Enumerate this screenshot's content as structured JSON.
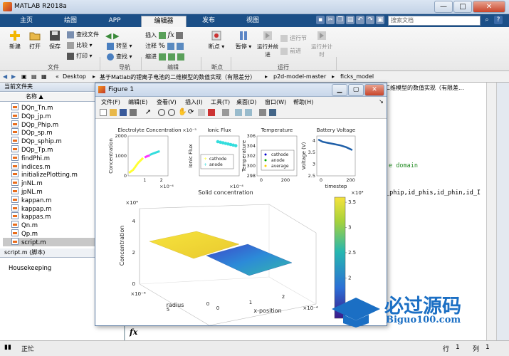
{
  "app": {
    "title": "MATLAB R2018a",
    "window_buttons": [
      "—",
      "□",
      "✕"
    ]
  },
  "ribbon": {
    "tabs": [
      "主页",
      "绘图",
      "APP",
      "编辑器",
      "发布",
      "视图"
    ],
    "active_tab": "编辑器",
    "search_placeholder": "搜索文档"
  },
  "toolstrip": {
    "file": {
      "new": "新建",
      "open": "打开",
      "save": "保存",
      "find_files": "查找文件",
      "compare": "比较",
      "print": "打印",
      "group": "文件"
    },
    "nav": {
      "goto": "转至",
      "find": "查找",
      "group": "导航"
    },
    "edit": {
      "insert": "插入",
      "comment": "注释",
      "indent": "缩进",
      "fx": "fx",
      "group": "编辑"
    },
    "breakpoints": {
      "label": "断点",
      "group": "断点"
    },
    "run": {
      "pause": "暂停",
      "run_advance": "运行并前进",
      "run_section": "运行节",
      "advance": "前进",
      "run_time": "运行并计时",
      "group": "运行"
    }
  },
  "address": {
    "crumbs": [
      "Desktop",
      "基于Matlab的锂离子电池的二维模型的数值实现（有限差分）",
      "p2d-model-master",
      "ficks_model"
    ]
  },
  "left_panel": {
    "header": "当前文件夹",
    "column": "名称",
    "sort_indicator": "▲",
    "files": [
      "DQn_Tn.m",
      "DQp_jp.m",
      "DQp_Phip.m",
      "DQp_sp.m",
      "DQp_sphip.m",
      "DQp_Tp.m",
      "findPhi.m",
      "indices.m",
      "initializePlotting.m",
      "jnNL.m",
      "jpNL.m",
      "kappan.m",
      "kappap.m",
      "kappas.m",
      "Qn.m",
      "Qp.m",
      "script.m"
    ],
    "selected_file": "script.m",
    "details_header": "script.m  (脚本)",
    "details_text": "Housekeeping"
  },
  "editor": {
    "tab_title": "二维模型的数值实现（有限差...",
    "line_comment": "e domain",
    "line_code": "_phip,id_phis,id_phin,id_I",
    "fx_label": "fx"
  },
  "status": {
    "text": "正忙",
    "row_label": "行",
    "row_value": "1",
    "col_label": "列",
    "col_value": "1"
  },
  "figure": {
    "title": "Figure 1",
    "menu": [
      "文件(F)",
      "编辑(E)",
      "查看(V)",
      "插入(I)",
      "工具(T)",
      "桌面(D)",
      "窗口(W)",
      "帮助(H)"
    ]
  },
  "chart_data": [
    {
      "type": "line",
      "title": "Electrolyte Concentration",
      "ylabel": "Concentration",
      "xlabel": "",
      "x_exponent": "×10⁻⁴",
      "xlim": [
        0,
        2.4
      ],
      "ylim": [
        0,
        2000
      ],
      "yticks": [
        0,
        1000,
        2000
      ],
      "xticks": [
        1,
        2
      ],
      "series": [
        {
          "color": "#ffff33",
          "x": [
            0.05,
            0.3,
            0.6,
            0.9
          ],
          "y": [
            150,
            300,
            650,
            900
          ]
        },
        {
          "color": "#ff33ff",
          "x": [
            1.0,
            1.1,
            1.2,
            1.3
          ],
          "y": [
            920,
            970,
            1000,
            1030
          ]
        },
        {
          "color": "#33dddd",
          "x": [
            1.3,
            1.5,
            1.7,
            1.9
          ],
          "y": [
            1050,
            1120,
            1180,
            1240
          ]
        }
      ]
    },
    {
      "type": "scatter",
      "title": "Ionic Flux",
      "ylabel": "Ionic Flux",
      "y_exponent": "×10⁻⁵",
      "x_exponent": "×10⁻⁴",
      "legend": [
        "cathode",
        "anode"
      ],
      "legend_colors": [
        "#ffff33",
        "#33dddd"
      ]
    },
    {
      "type": "scatter",
      "title": "Temperature",
      "ylabel": "Temperature",
      "yticks": [
        298,
        300,
        302,
        304,
        306
      ],
      "xticks": [
        0,
        200
      ],
      "ylim": [
        298,
        306
      ],
      "legend": [
        "cathode",
        "anode",
        "average"
      ],
      "legend_colors": [
        "#0000cc",
        "#00aa00",
        "#ffcc00"
      ]
    },
    {
      "type": "line",
      "title": "Battery Voltage",
      "ylabel": "Voltage (V)",
      "xlabel": "timestep",
      "yticks": [
        2.5,
        3,
        3.5,
        4
      ],
      "xticks": [
        0,
        200
      ],
      "ylim": [
        2.5,
        4.2
      ],
      "series": [
        {
          "color": "#1f5fa8",
          "x": [
            10,
            40,
            80,
            120,
            160,
            200,
            240
          ],
          "y": [
            4.05,
            3.95,
            3.9,
            3.85,
            3.8,
            3.72,
            3.6
          ]
        }
      ]
    },
    {
      "type": "heatmap",
      "title": "Solid concentration",
      "xlabel": "x-position",
      "ylabel": "radius",
      "zlabel": "Concentration",
      "z_exponent": "×10⁴",
      "x_exponent": "×10⁻⁴",
      "y_exponent": "×10⁻⁶",
      "zticks": [
        0,
        2,
        4
      ],
      "xticks": [
        0,
        1,
        2
      ],
      "yticks": [
        0,
        5
      ],
      "colorbar_ticks": [
        1.5,
        2,
        2.5,
        3,
        3.5
      ],
      "colorbar_exponent": "×10⁴",
      "colorbar_range": [
        1.2,
        3.6
      ]
    }
  ],
  "watermark": {
    "brand": "必过源码",
    "url": "Biguo100.com"
  }
}
